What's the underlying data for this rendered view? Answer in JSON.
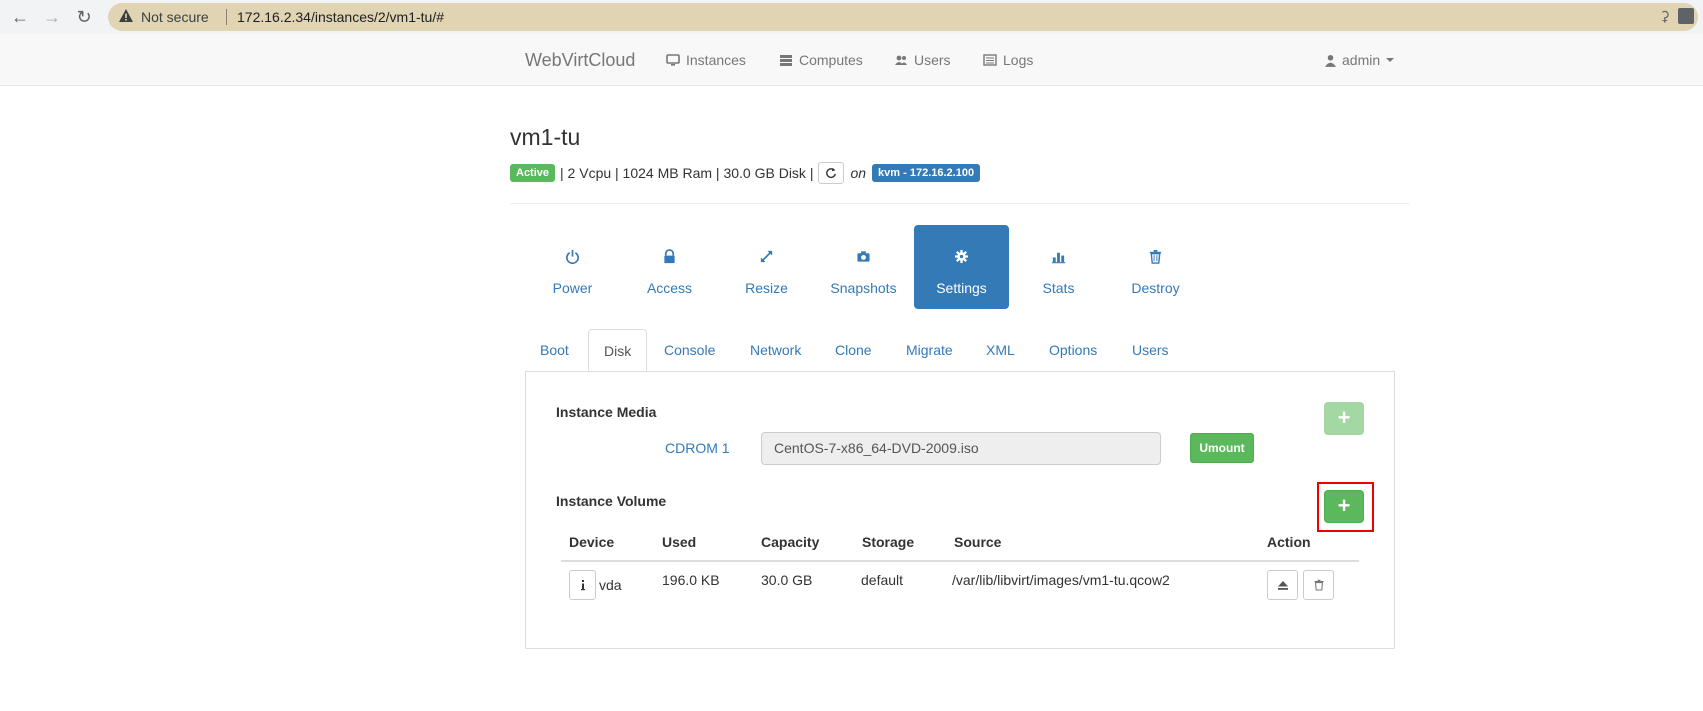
{
  "browser": {
    "security_label": "Not secure",
    "url": "172.16.2.34/instances/2/vm1-tu/#"
  },
  "navbar": {
    "brand": "WebVirtCloud",
    "items": [
      {
        "label": "Instances",
        "icon": "desktop-icon"
      },
      {
        "label": "Computes",
        "icon": "server-icon"
      },
      {
        "label": "Users",
        "icon": "users-icon"
      },
      {
        "label": "Logs",
        "icon": "list-icon"
      }
    ],
    "user": "admin"
  },
  "instance": {
    "name": "vm1-tu",
    "status": "Active",
    "specs": "| 2 Vcpu | 1024 MB Ram | 30.0 GB Disk |",
    "on_label": "on",
    "host": "kvm - 172.16.2.100"
  },
  "actions": [
    {
      "label": "Power",
      "icon": "power-icon"
    },
    {
      "label": "Access",
      "icon": "lock-icon"
    },
    {
      "label": "Resize",
      "icon": "resize-icon"
    },
    {
      "label": "Snapshots",
      "icon": "camera-icon"
    },
    {
      "label": "Settings",
      "icon": "gear-icon",
      "active": true
    },
    {
      "label": "Stats",
      "icon": "stats-icon"
    },
    {
      "label": "Destroy",
      "icon": "trash-icon"
    }
  ],
  "tabs": [
    {
      "label": "Boot"
    },
    {
      "label": "Disk",
      "active": true
    },
    {
      "label": "Console"
    },
    {
      "label": "Network"
    },
    {
      "label": "Clone"
    },
    {
      "label": "Migrate"
    },
    {
      "label": "XML"
    },
    {
      "label": "Options"
    },
    {
      "label": "Users"
    }
  ],
  "disk": {
    "media_title": "Instance Media",
    "cdrom_label": "CDROM 1",
    "cdrom_value": "CentOS-7-x86_64-DVD-2009.iso",
    "umount_label": "Umount",
    "add_label": "+",
    "volume_title": "Instance Volume",
    "columns": [
      "Device",
      "Used",
      "Capacity",
      "Storage",
      "Source",
      "Action"
    ],
    "rows": [
      {
        "device": "vda",
        "used": "196.0 KB",
        "capacity": "30.0 GB",
        "storage": "default",
        "source": "/var/lib/libvirt/images/vm1-tu.qcow2"
      }
    ]
  },
  "colors": {
    "primary": "#337ab7",
    "success": "#5cb85c",
    "highlight": "#ee0000"
  }
}
